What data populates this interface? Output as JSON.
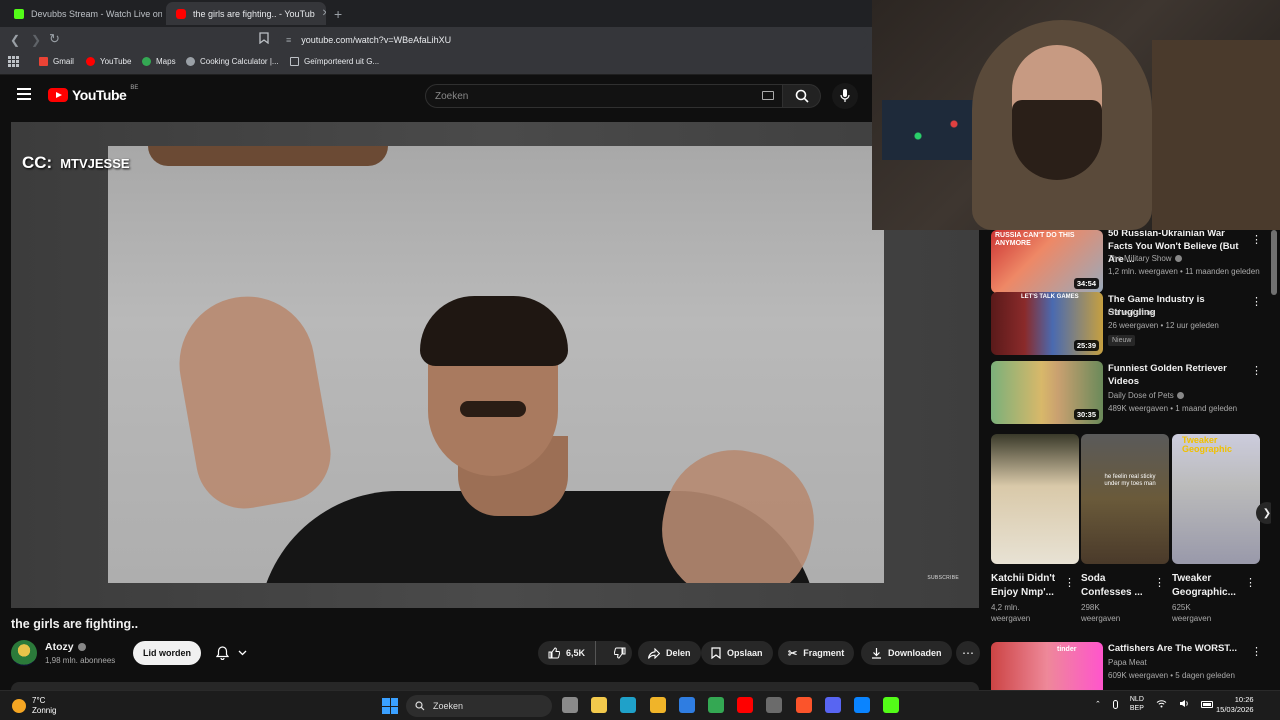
{
  "browser": {
    "tabs": [
      {
        "title": "Devubbs Stream - Watch Live on",
        "favicon_color": "#53fc18",
        "active": false
      },
      {
        "title": "the girls are fighting.. - YouTub",
        "favicon_color": "#ff0000",
        "active": true
      }
    ],
    "url": "youtube.com/watch?v=WBeAfaLihXU",
    "bookmarks": [
      {
        "label": "Gmail",
        "icon": "gmail-icon",
        "color": "#ea4335"
      },
      {
        "label": "YouTube",
        "icon": "youtube-icon",
        "color": "#ff0000"
      },
      {
        "label": "Maps",
        "icon": "maps-icon",
        "color": "#34a853"
      },
      {
        "label": "Cooking Calculator |...",
        "icon": "calculator-icon",
        "color": "#9aa0a6"
      },
      {
        "label": "Geïmporteerd uit G...",
        "icon": "folder-icon",
        "color": "#bdc1c6"
      }
    ]
  },
  "youtube": {
    "logo_text": "YouTube",
    "country_code": "BE",
    "search_placeholder": "Zoeken"
  },
  "video": {
    "overlay_prefix": "CC:",
    "overlay_name": "MTVJESSE",
    "overlay_subscribe": "SUBSCRIBE",
    "title": "the girls are fighting..",
    "channel": "Atozy",
    "subscribers": "1,98 mln. abonnees",
    "join_label": "Lid worden",
    "likes": "6,5K",
    "share_label": "Delen",
    "save_label": "Opslaan",
    "clip_label": "Fragment",
    "download_label": "Downloaden"
  },
  "recommendations": [
    {
      "title": "50 Russian-Ukrainian War Facts You Won't Believe (But Are ...",
      "channel": "The Military Show",
      "verified": true,
      "meta": "1,2 mln. weergaven • 11 maanden geleden",
      "duration": "34:54",
      "thumb_text": "RUSSIA CAN'T DO THIS ANYMORE",
      "badge": ""
    },
    {
      "title": "The Game Industry is Struggling",
      "channel": "Ohheyitsmax",
      "verified": false,
      "meta": "26 weergaven • 12 uur geleden",
      "duration": "25:39",
      "thumb_text": "LET'S TALK GAMES",
      "badge": "Nieuw"
    },
    {
      "title": "Funniest Golden Retriever Videos",
      "channel": "Daily Dose of Pets",
      "verified": true,
      "meta": "489K weergaven • 1 maand geleden",
      "duration": "30:35",
      "thumb_text": "",
      "badge": ""
    },
    {
      "title": "Catfishers Are The WORST...",
      "channel": "Papa Meat",
      "verified": false,
      "meta": "609K weergaven • 5 dagen geleden",
      "duration": "",
      "thumb_text": "tinder",
      "badge": ""
    }
  ],
  "shorts": [
    {
      "title": "Katchii Didn't Enjoy Nmp'...",
      "views": "4,2 mln. weergaven",
      "thumb_text": ""
    },
    {
      "title": "Soda Confesses ...",
      "views": "298K weergaven",
      "thumb_text": "he feelin real sticky under my toes man"
    },
    {
      "title": "Tweaker Geographic...",
      "views": "625K weergaven",
      "thumb_text": "Tweaker Geographic"
    }
  ],
  "taskbar": {
    "weather_temp": "7°C",
    "weather_desc": "Zonnig",
    "search_label": "Zoeken",
    "lang_top": "NLD",
    "lang_bottom": "BEP",
    "time": "10:26",
    "date": "15/03/2026",
    "apps": [
      {
        "name": "task-view-icon",
        "color": "#8a8a8a"
      },
      {
        "name": "store-icon",
        "color": "#f2c94c"
      },
      {
        "name": "edge-icon",
        "color": "#1fa1c9"
      },
      {
        "name": "file-explorer-icon",
        "color": "#f0b429"
      },
      {
        "name": "mail-icon",
        "color": "#2f7de1"
      },
      {
        "name": "chrome-icon",
        "color": "#34a853"
      },
      {
        "name": "youtube-app-icon",
        "color": "#ff0000"
      },
      {
        "name": "calculator-app-icon",
        "color": "#6b6b6b"
      },
      {
        "name": "brave-icon",
        "color": "#fb542b"
      },
      {
        "name": "discord-icon",
        "color": "#5865f2"
      },
      {
        "name": "app-blue-icon",
        "color": "#0a84ff"
      },
      {
        "name": "kick-icon",
        "color": "#53fc18"
      }
    ]
  }
}
